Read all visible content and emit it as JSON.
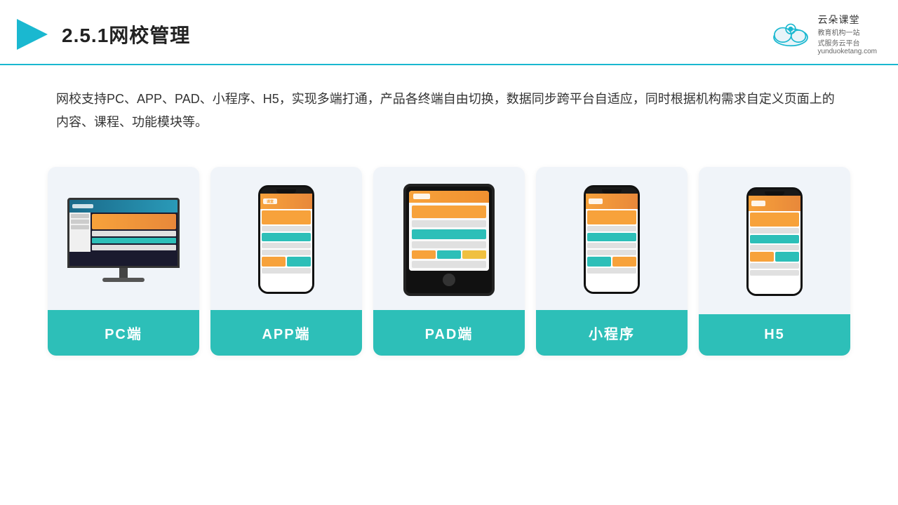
{
  "header": {
    "title": "2.5.1网校管理",
    "logo_name": "云朵课堂",
    "logo_sub1": "教育机构一站",
    "logo_sub2": "式服务云平台",
    "logo_domain": "yunduoketang.com"
  },
  "description": {
    "text": "网校支持PC、APP、PAD、小程序、H5，实现多端打通，产品各终端自由切换，数据同步跨平台自适应，同时根据机构需求自定义页面上的内容、课程、功能模块等。"
  },
  "cards": [
    {
      "id": "pc",
      "label": "PC端"
    },
    {
      "id": "app",
      "label": "APP端"
    },
    {
      "id": "pad",
      "label": "PAD端"
    },
    {
      "id": "miniapp",
      "label": "小程序"
    },
    {
      "id": "h5",
      "label": "H5"
    }
  ]
}
